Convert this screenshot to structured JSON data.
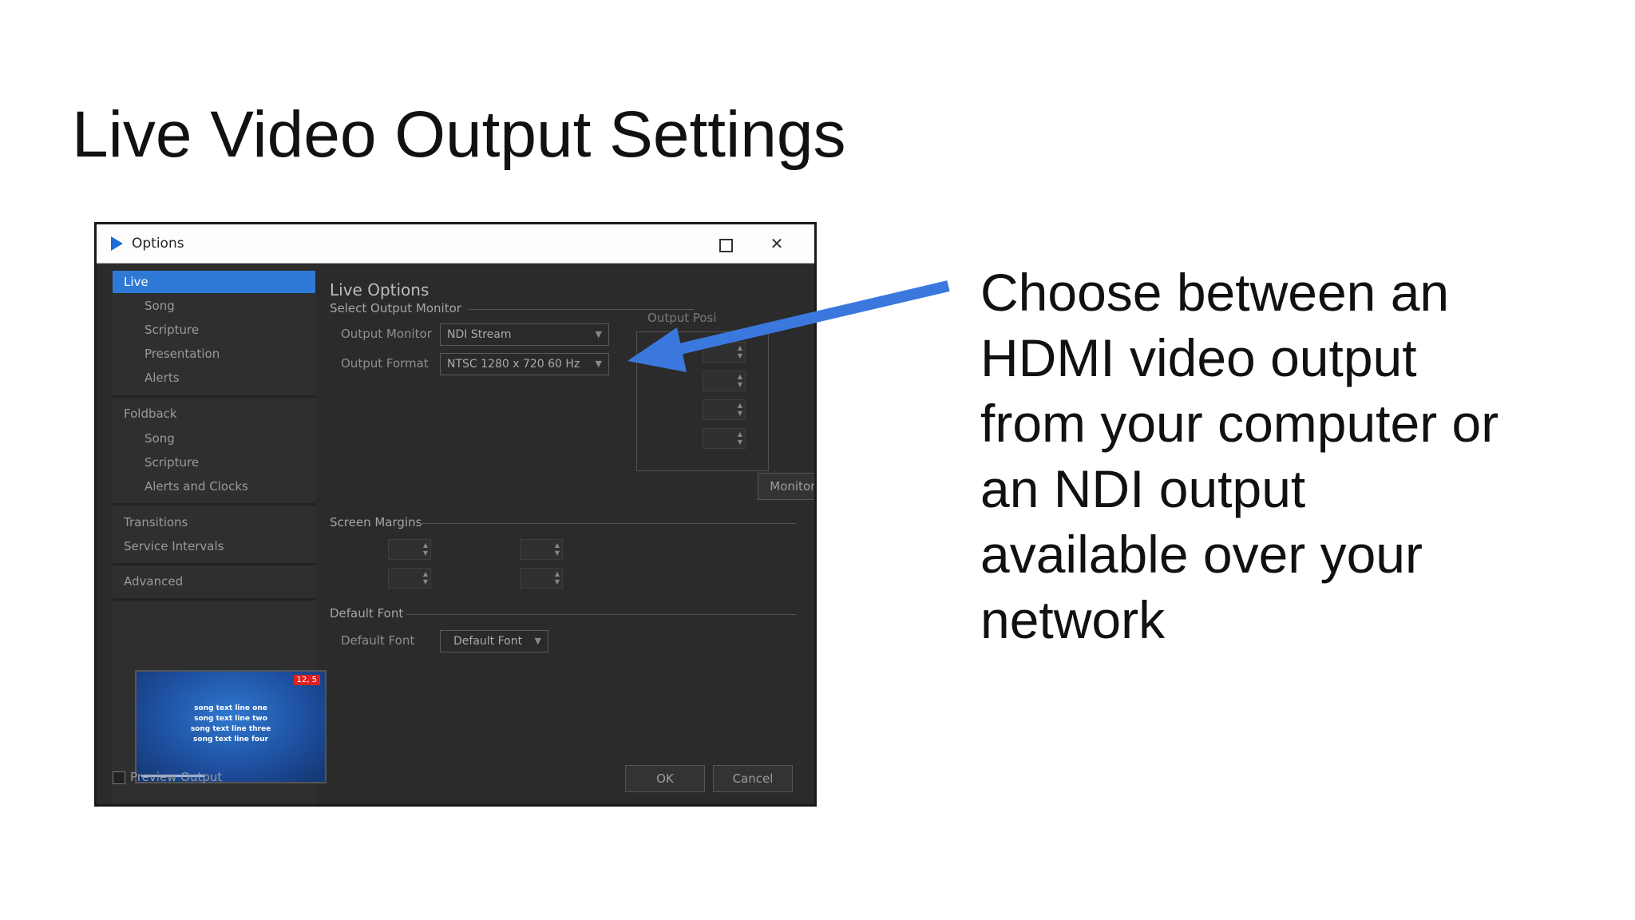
{
  "slide": {
    "title": "Live Video Output Settings",
    "caption_lines": [
      "Choose between an",
      "HDMI video output",
      "from your computer or",
      "an NDI output",
      "available over your",
      "network"
    ]
  },
  "dialog": {
    "title": "Options",
    "nav": {
      "live": "Live",
      "live_song": "Song",
      "live_scripture": "Scripture",
      "live_presentation": "Presentation",
      "live_alerts": "Alerts",
      "foldback": "Foldback",
      "foldback_song": "Song",
      "foldback_scripture": "Scripture",
      "foldback_alerts": "Alerts and Clocks",
      "transitions": "Transitions",
      "service_intervals": "Service Intervals",
      "advanced": "Advanced"
    },
    "preview": {
      "badge": "12, 5",
      "lines": [
        "song text line one",
        "song text line two",
        "song text line three",
        "song text line four"
      ]
    },
    "preview_output_label": "Preview Output",
    "content": {
      "heading": "Live Options",
      "select_output_monitor": "Select Output Monitor",
      "output_monitor_label": "Output Monitor",
      "output_monitor_value": "NDI Stream",
      "output_format_label": "Output Format",
      "output_format_value": "NTSC 1280 x 720  60 Hz",
      "output_position_label": "Output Posi",
      "monitor_setup_button": "Monitor Setup",
      "screen_margins": "Screen Margins",
      "default_font_group": "Default Font",
      "default_font_label": "Default Font",
      "default_font_value": "Default Font"
    },
    "ok_button": "OK",
    "cancel_button": "Cancel"
  },
  "colors": {
    "accent": "#2f79d6",
    "annotation_arrow": "#3b78de",
    "dialog_bg": "#2b2b2b"
  }
}
